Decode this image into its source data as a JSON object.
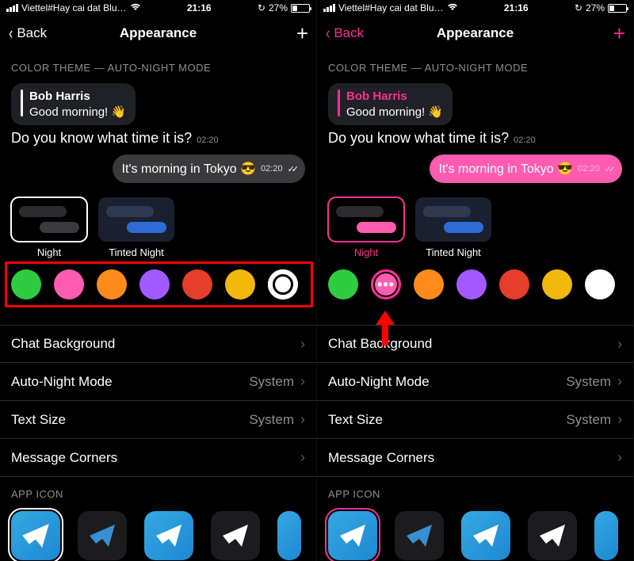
{
  "status": {
    "carrier": "Viettel#Hay cai dat Blu…",
    "time": "21:16",
    "battery_pct": "27%"
  },
  "nav": {
    "back": "Back",
    "title": "Appearance",
    "add_icon": "+"
  },
  "section": {
    "color_theme": "COLOR THEME — AUTO-NIGHT MODE",
    "app_icon": "APP ICON"
  },
  "chat": {
    "sender": "Bob Harris",
    "greeting": "Good morning! 👋",
    "question": "Do you know what time it is?",
    "ts_in": "02:20",
    "reply": "It's morning in Tokyo 😎",
    "ts_out": "02:20"
  },
  "themes": {
    "night": "Night",
    "tinted": "Tinted Night"
  },
  "swatches": {
    "colors": [
      "#2ecc40",
      "#ff5bb0",
      "#ff8c1a",
      "#a259ff",
      "#e63e2b",
      "#f2b90c",
      "#ffffff"
    ],
    "left_selected_index": 6,
    "right_selected_index": 1
  },
  "settings": {
    "chat_bg": "Chat Background",
    "auto_night": "Auto-Night Mode",
    "auto_night_val": "System",
    "text_size": "Text Size",
    "text_size_val": "System",
    "msg_corners": "Message Corners"
  },
  "accent": {
    "left": "#ffffff",
    "right": "#ff2d95"
  }
}
